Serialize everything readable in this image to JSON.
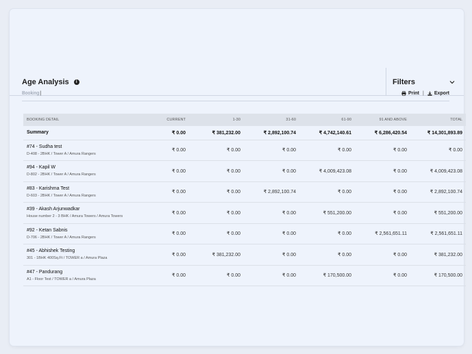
{
  "header": {
    "title": "Age Analysis",
    "filters_label": "Filters"
  },
  "subbar": {
    "tab_label": "Booking",
    "print_label": "Print",
    "export_label": "Export"
  },
  "table": {
    "columns": [
      "BOOKING DETAIL",
      "CURRENT",
      "1-30",
      "31-60",
      "61-90",
      "91 AND ABOVE",
      "TOTAL"
    ],
    "summary": {
      "label": "Summary",
      "values": [
        "₹ 0.00",
        "₹ 381,232.00",
        "₹ 2,892,100.74",
        "₹ 4,742,140.61",
        "₹ 6,286,420.54",
        "₹ 14,301,893.89"
      ]
    },
    "rows": [
      {
        "name": "#74 - Sudha test",
        "sub": "D-408 - 2BHK / Tower A / Amura Rangers",
        "values": [
          "₹ 0.00",
          "₹ 0.00",
          "₹ 0.00",
          "₹ 0.00",
          "₹ 0.00",
          "₹ 0.00"
        ]
      },
      {
        "name": "#94 - Kapil W",
        "sub": "D-802 - 2BHK / Tower A / Amura Rangers",
        "values": [
          "₹ 0.00",
          "₹ 0.00",
          "₹ 0.00",
          "₹ 4,009,423.08",
          "₹ 0.00",
          "₹ 4,009,423.08"
        ]
      },
      {
        "name": "#83 - Karishma Test",
        "sub": "D-603 - 2BHK / Tower A / Amura Rangers",
        "values": [
          "₹ 0.00",
          "₹ 0.00",
          "₹ 2,892,100.74",
          "₹ 0.00",
          "₹ 0.00",
          "₹ 2,892,100.74"
        ]
      },
      {
        "name": "#39 - Akash Arjunwadkar",
        "sub": "House number 2 - 3 BHK / Amura Towers / Amura Towers",
        "values": [
          "₹ 0.00",
          "₹ 0.00",
          "₹ 0.00",
          "₹ 551,200.00",
          "₹ 0.00",
          "₹ 551,200.00"
        ]
      },
      {
        "name": "#92 - Ketan Sabnis",
        "sub": "D-706 - 2BHK / Tower A / Amura Rangers",
        "values": [
          "₹ 0.00",
          "₹ 0.00",
          "₹ 0.00",
          "₹ 0.00",
          "₹ 2,561,651.11",
          "₹ 2,561,651.11"
        ]
      },
      {
        "name": "#45 - Abhishek Testing",
        "sub": "301 - 1BHK 400Sq.Ft / TOWER a / Amura Plaza",
        "values": [
          "₹ 0.00",
          "₹ 381,232.00",
          "₹ 0.00",
          "₹ 0.00",
          "₹ 0.00",
          "₹ 381,232.00"
        ]
      },
      {
        "name": "#47 - Pandurang",
        "sub": "A1 - Floor Test / TOWER a / Amura Plaza",
        "values": [
          "₹ 0.00",
          "₹ 0.00",
          "₹ 0.00",
          "₹ 170,500.00",
          "₹ 0.00",
          "₹ 170,500.00"
        ]
      }
    ]
  }
}
